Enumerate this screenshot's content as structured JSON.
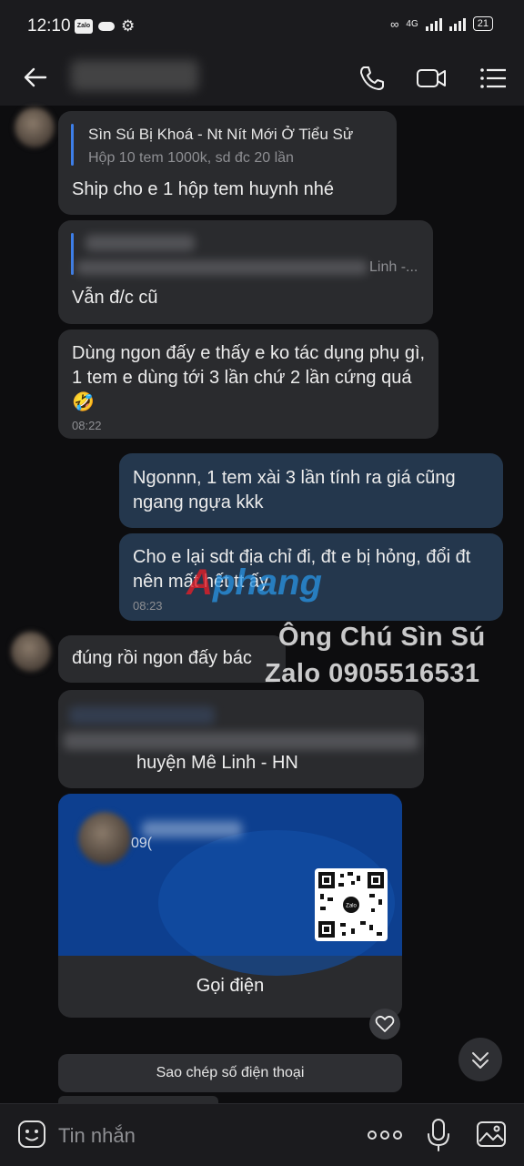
{
  "status_bar": {
    "time": "12:10",
    "network": "4G",
    "battery": "21"
  },
  "header": {},
  "messages": {
    "quote1_title": "Sìn Sú Bị Khoá - Nt Nít Mới Ở Tiểu Sử",
    "quote1_sub": "Hộp 10 tem 1000k, sd đc 20 lần",
    "msg1": "Ship cho e 1 hộp tem huynh nhé",
    "quote2_tail": "Linh -...",
    "msg2": "Vẫn đ/c cũ",
    "msg3": "Dùng ngon đấy e thấy e ko tác dụng phụ gì, 1 tem e dùng tới 3 lần chứ 2 lần cứng quá 🤣",
    "msg3_time": "08:22",
    "msg4": "Ngonnn, 1 tem xài 3 lần tính ra giá cũng ngang ngựa kkk",
    "msg5": "Cho e lại sdt địa chỉ đi, đt e bị hỏng, đổi đt nên mất hết tt ấy",
    "msg5_time": "08:23",
    "msg6": "đúng rồi ngon đấy bác",
    "msg7_tail": "huyện Mê Linh - HN"
  },
  "watermark": {
    "line1": "Ông Chú Sìn Sú",
    "line2": "Zalo 0905516531",
    "logo_a": "A",
    "logo_b": "phang"
  },
  "contact_card": {
    "phone_partial": "09(",
    "qr_label": "Zalo",
    "call_label": "Gọi điện"
  },
  "actions": {
    "copy_phone": "Sao chép số điện thoại"
  },
  "input": {
    "placeholder": "Tin nhắn"
  },
  "colors": {
    "accent": "#3d7ee8",
    "bubble_mine": "#24374d",
    "bubble_other": "#2a2b2e",
    "card": "#0d3f8f"
  }
}
